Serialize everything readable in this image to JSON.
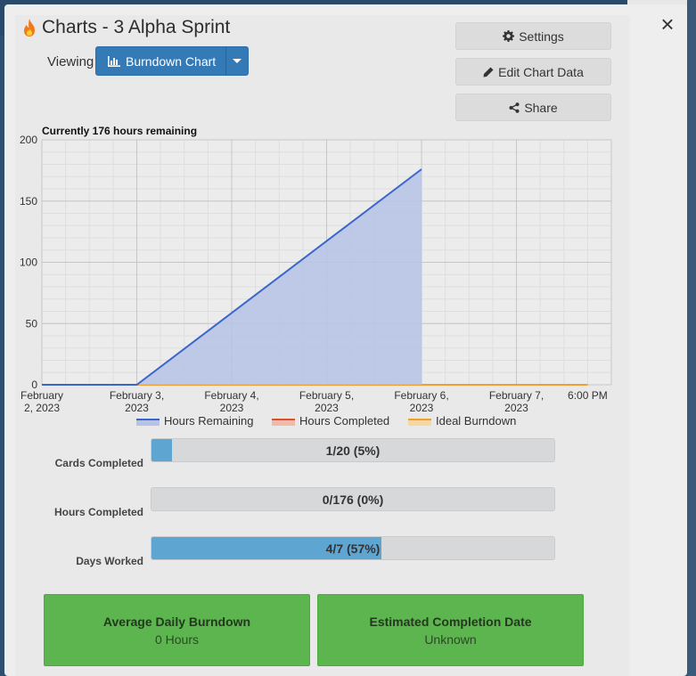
{
  "window": {
    "title": "Charts - 3 Alpha Sprint",
    "close_glyph": "×"
  },
  "viewing": {
    "label": "Viewing",
    "selected_chart": "Burndown Chart"
  },
  "actions": {
    "settings": "Settings",
    "edit": "Edit Chart Data",
    "share": "Share"
  },
  "chart_data": {
    "type": "area",
    "title": "Currently 176 hours remaining",
    "x_tick_labels": [
      [
        "February",
        "2, 2023"
      ],
      [
        "February 3,",
        "2023"
      ],
      [
        "February 4,",
        "2023"
      ],
      [
        "February 5,",
        "2023"
      ],
      [
        "February 6,",
        "2023"
      ],
      [
        "February 7,",
        "2023"
      ],
      [
        "6:00 PM",
        ""
      ]
    ],
    "y_ticks": [
      0,
      50,
      100,
      150,
      200
    ],
    "ylim": [
      0,
      200
    ],
    "series": [
      {
        "name": "Hours Remaining",
        "color": "#3a66cc",
        "fill": "#b6c3e6",
        "points": [
          {
            "x": "2023-02-02 00:00",
            "y": 0
          },
          {
            "x": "2023-02-03 00:00",
            "y": 0
          },
          {
            "x": "2023-02-06 00:00",
            "y": 176
          }
        ]
      },
      {
        "name": "Hours Completed",
        "color": "#d9502d",
        "fill": "#f2b9a8",
        "points": [
          {
            "x": "2023-02-02 00:00",
            "y": 0
          },
          {
            "x": "2023-02-07 18:00",
            "y": 0
          }
        ]
      },
      {
        "name": "Ideal Burndown",
        "color": "#f0a030",
        "fill": "#f7d7a0",
        "points": [
          {
            "x": "2023-02-02 00:00",
            "y": 0
          },
          {
            "x": "2023-02-07 18:00",
            "y": 0
          }
        ]
      }
    ],
    "grid": true,
    "legend_position": "bottom"
  },
  "metrics": [
    {
      "label": "Cards Completed",
      "text": "1/20 (5%)",
      "fraction": 0.05
    },
    {
      "label": "Hours Completed",
      "text": "0/176 (0%)",
      "fraction": 0.0
    },
    {
      "label": "Days Worked",
      "text": "4/7 (57%)",
      "fraction": 0.57
    }
  ],
  "stats": [
    {
      "title": "Average Daily Burndown",
      "value": "0 Hours"
    },
    {
      "title": "Estimated Completion Date",
      "value": "Unknown"
    }
  ],
  "icons": {
    "title_icon": "flame-icon",
    "chart_icon": "bar-chart-icon",
    "settings_icon": "gear-icon",
    "edit_icon": "pencil-icon",
    "share_icon": "share-icon",
    "close_icon": "close-icon"
  }
}
